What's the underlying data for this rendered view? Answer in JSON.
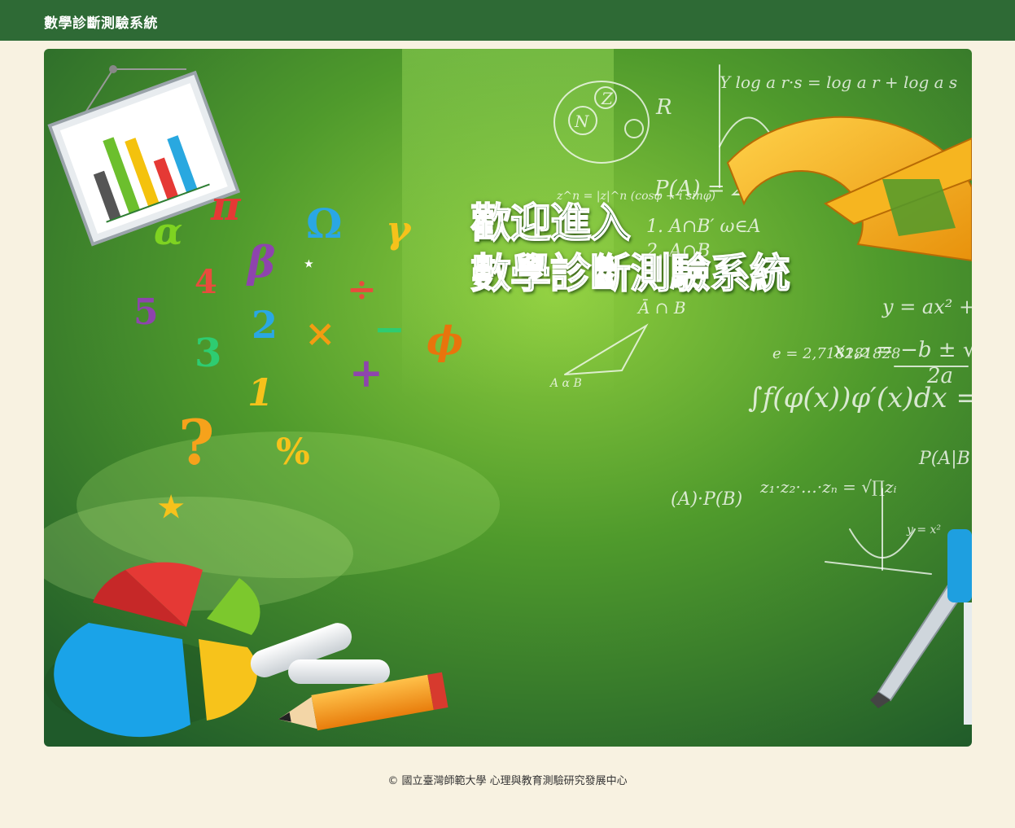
{
  "header": {
    "app_title": "數學診斷測驗系統"
  },
  "banner": {
    "headline_line1": "歡迎進入",
    "headline_line2": "數學診斷測驗系統"
  },
  "footer": {
    "copyright": "© 國立臺灣師範大學 心理與教育測驗研究發展中心"
  },
  "colors": {
    "header_bg": "#2e6a35",
    "page_bg": "#f8f2e1"
  }
}
